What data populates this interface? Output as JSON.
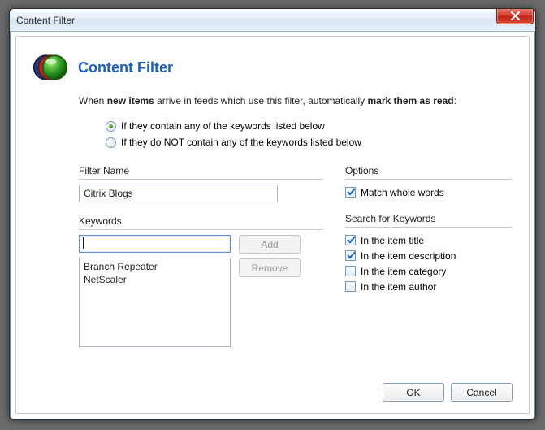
{
  "window": {
    "title": "Content Filter"
  },
  "header": {
    "title": "Content Filter"
  },
  "intro": {
    "prefix": "When ",
    "bold1": "new items",
    "mid": " arrive in feeds which use this filter, automatically ",
    "bold2": "mark them as read",
    "suffix": ":"
  },
  "radios": {
    "option_contain": "If they contain any of the keywords listed below",
    "option_not_contain": "If they do NOT contain any of the keywords listed below",
    "selected": "contain"
  },
  "filter_name": {
    "label": "Filter Name",
    "value": "Citrix Blogs"
  },
  "keywords": {
    "label": "Keywords",
    "input_value": "",
    "add_label": "Add",
    "remove_label": "Remove",
    "items": [
      "Branch Repeater",
      "NetScaler"
    ]
  },
  "options": {
    "label": "Options",
    "match_whole": {
      "label": "Match whole words",
      "checked": true
    }
  },
  "search": {
    "label": "Search for Keywords",
    "in_title": {
      "label": "In the item title",
      "checked": true
    },
    "in_description": {
      "label": "In the item description",
      "checked": true
    },
    "in_category": {
      "label": "In the item category",
      "checked": false
    },
    "in_author": {
      "label": "In the item author",
      "checked": false
    }
  },
  "footer": {
    "ok": "OK",
    "cancel": "Cancel"
  }
}
